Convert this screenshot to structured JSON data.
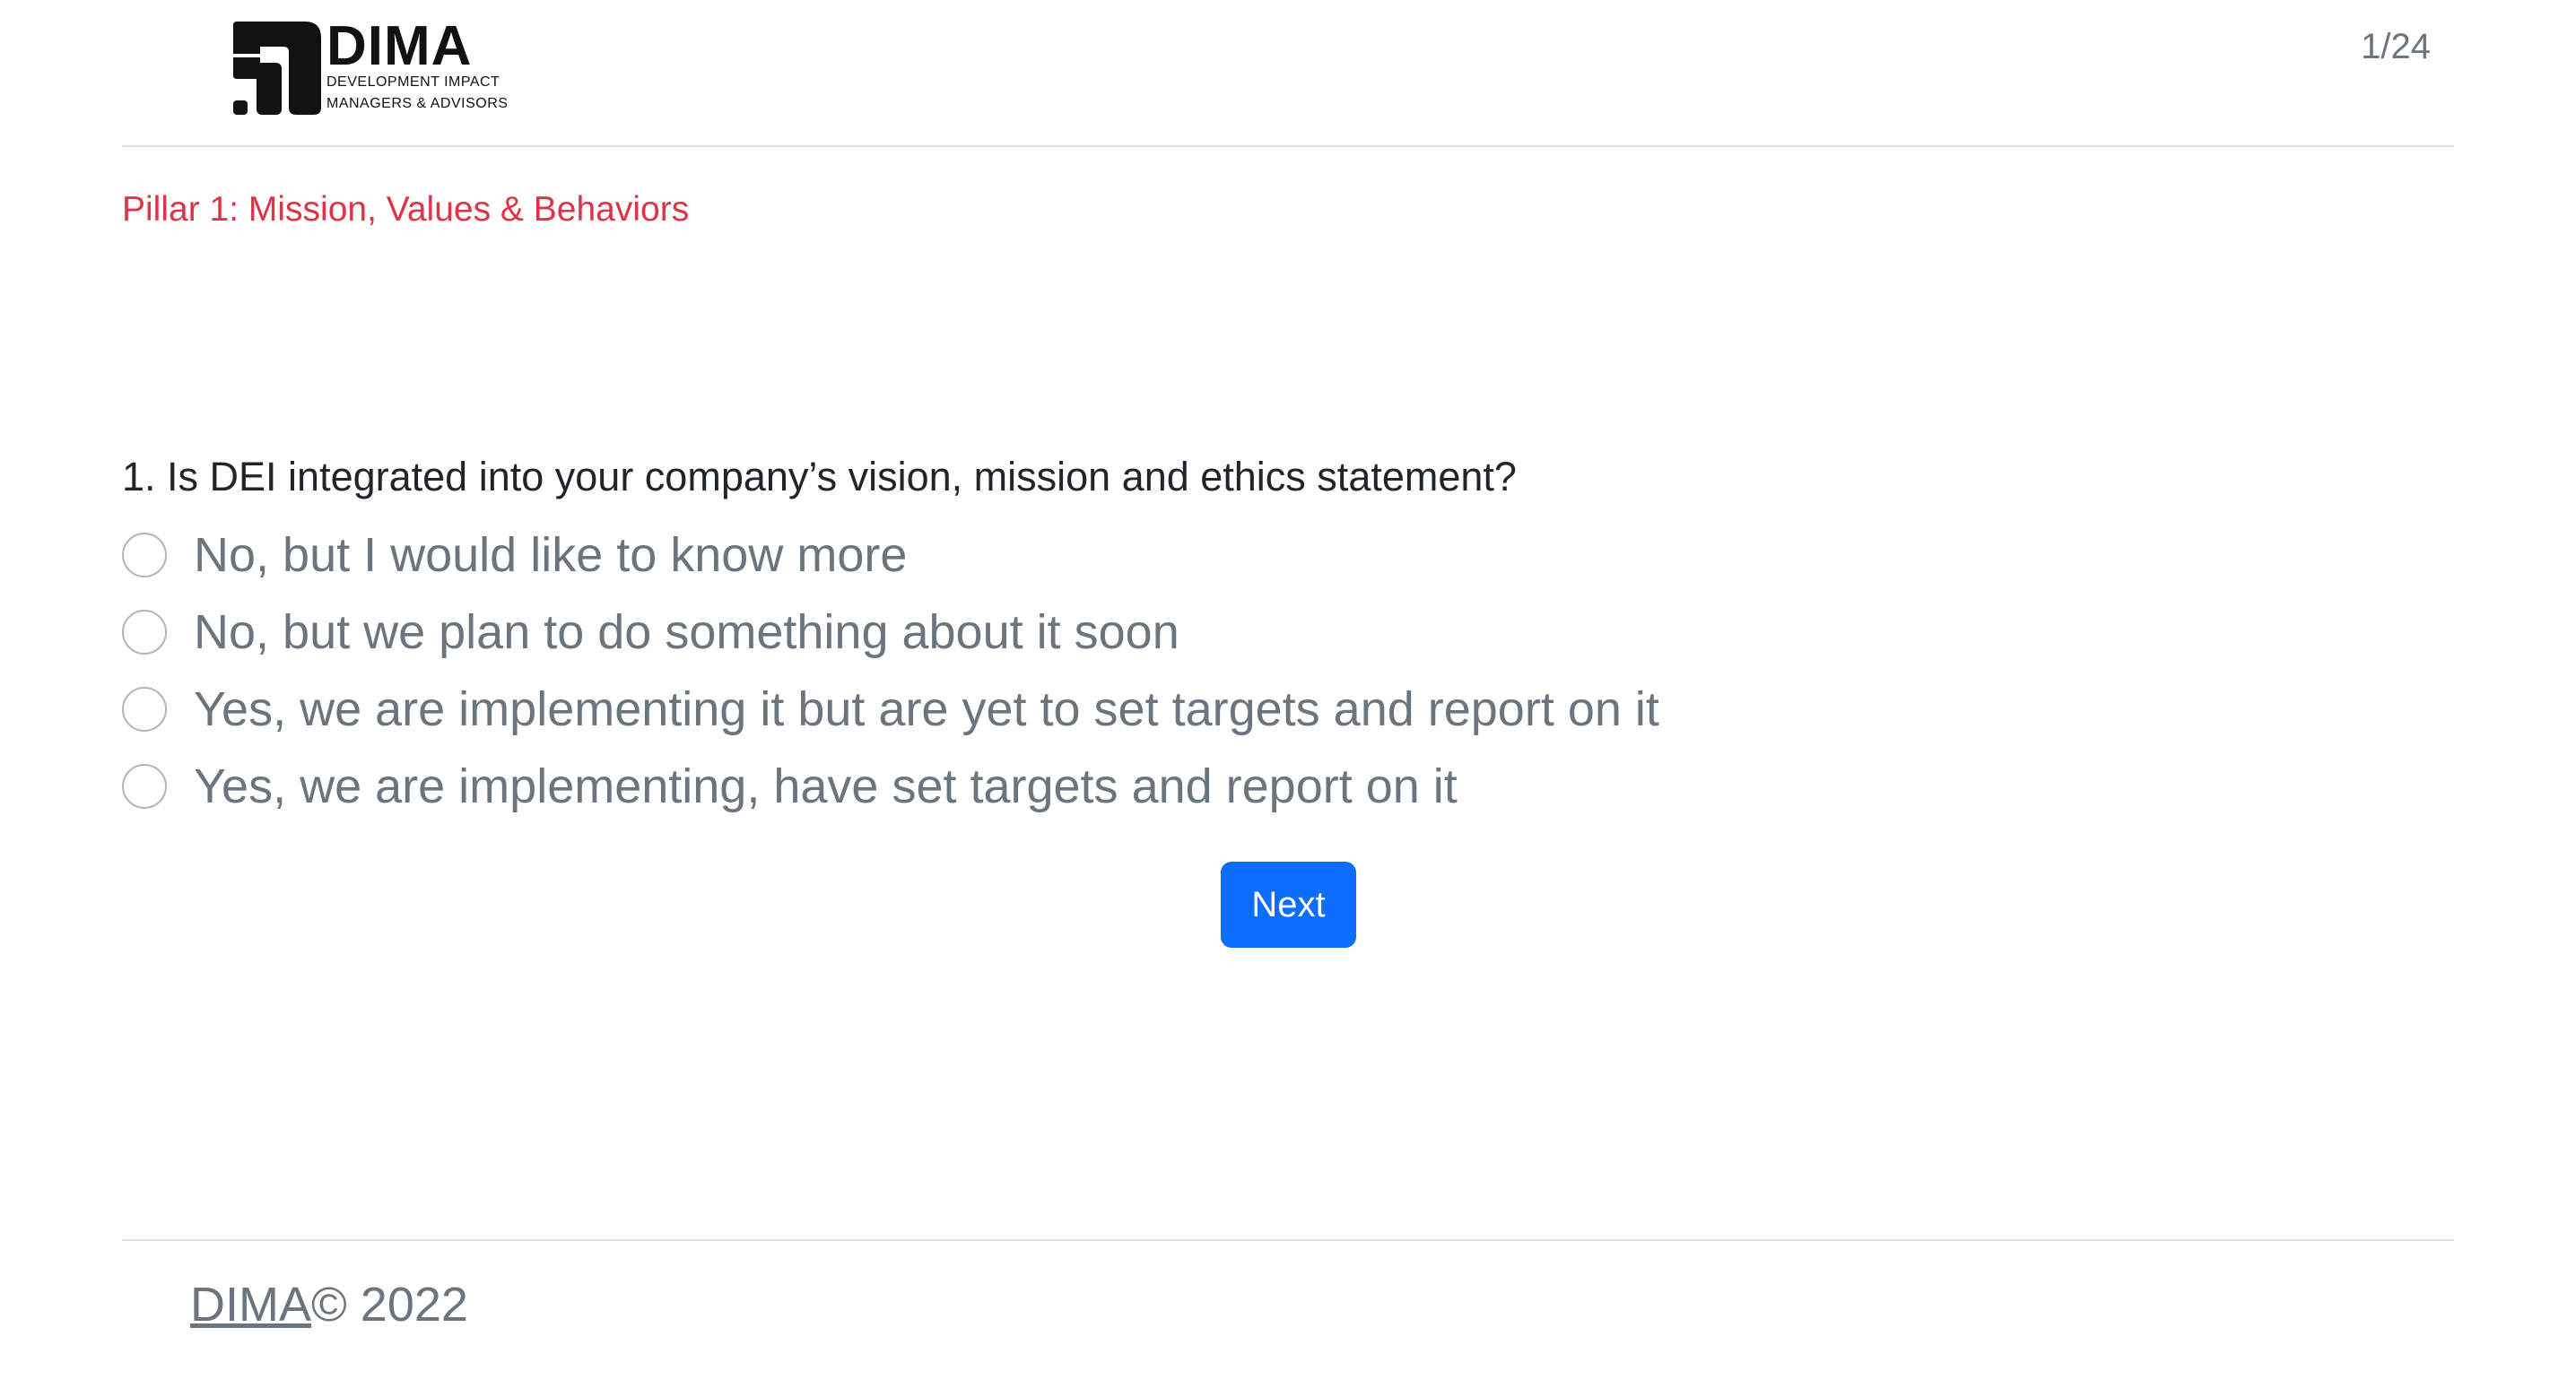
{
  "header": {
    "logo_title": "DIMA",
    "logo_subtitle_line1": "DEVELOPMENT IMPACT",
    "logo_subtitle_line2": "MANAGERS & ADVISORS",
    "page_counter": "1/24"
  },
  "section": {
    "pillar_title": "Pillar 1: Mission, Values & Behaviors"
  },
  "question": {
    "text": "1. Is DEI integrated into your company’s vision, mission and ethics statement?",
    "options": [
      {
        "label": "No, but I would like to know more",
        "selected": false
      },
      {
        "label": "No, but we plan to do something about it soon",
        "selected": false
      },
      {
        "label": "Yes, we are implementing it but are yet to set targets and report on it",
        "selected": false
      },
      {
        "label": "Yes, we are implementing, have set targets and report on it",
        "selected": false
      }
    ]
  },
  "actions": {
    "next_label": "Next"
  },
  "footer": {
    "link_text": "DIMA",
    "copyright_text": "© 2022"
  },
  "colors": {
    "accent_red": "#dc3545",
    "primary_blue": "#0d6efd",
    "muted_text": "#6c757d",
    "divider": "#dee2e6"
  }
}
